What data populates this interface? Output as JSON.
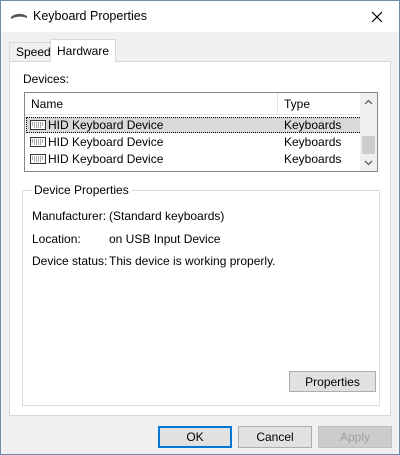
{
  "window": {
    "title": "Keyboard Properties"
  },
  "tabs": [
    {
      "label": "Speed",
      "active": false
    },
    {
      "label": "Hardware",
      "active": true
    }
  ],
  "devices": {
    "label": "Devices:",
    "columns": [
      "Name",
      "Type"
    ],
    "rows": [
      {
        "name": "HID Keyboard Device",
        "type": "Keyboards",
        "selected": true
      },
      {
        "name": "HID Keyboard Device",
        "type": "Keyboards",
        "selected": false
      },
      {
        "name": "HID Keyboard Device",
        "type": "Keyboards",
        "selected": false
      }
    ]
  },
  "device_properties": {
    "title": "Device Properties",
    "manufacturer_label": "Manufacturer:",
    "manufacturer_value": "(Standard keyboards)",
    "location_label": "Location:",
    "location_value": "on USB Input Device",
    "status_label": "Device status:",
    "status_value": "This device is working properly.",
    "properties_button": "Properties"
  },
  "buttons": {
    "ok": "OK",
    "cancel": "Cancel",
    "apply": "Apply"
  },
  "icons": {
    "title": "keyboard-icon",
    "close": "close-icon",
    "device": "keyboard-device-icon"
  },
  "colors": {
    "accent": "#0078d7",
    "selection": "#d9d9d9"
  }
}
